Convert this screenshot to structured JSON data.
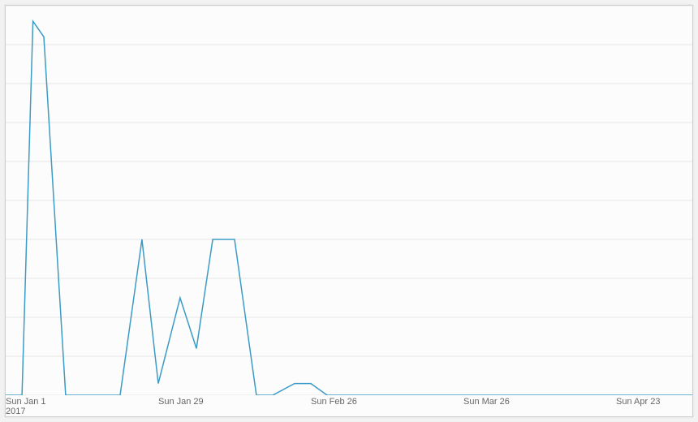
{
  "chart_data": {
    "type": "line",
    "x": [
      "2017-01-01",
      "2017-01-04",
      "2017-01-06",
      "2017-01-08",
      "2017-01-12",
      "2017-01-15",
      "2017-01-22",
      "2017-01-26",
      "2017-01-29",
      "2017-02-02",
      "2017-02-05",
      "2017-02-08",
      "2017-02-12",
      "2017-02-16",
      "2017-02-19",
      "2017-02-23",
      "2017-02-26",
      "2017-03-01",
      "2017-03-05",
      "2017-03-26",
      "2017-04-23",
      "2017-05-07"
    ],
    "values": [
      0,
      0,
      96,
      92,
      0,
      0,
      0,
      40,
      3,
      25,
      12,
      40,
      40,
      0,
      0,
      3,
      3,
      0,
      0,
      0,
      0,
      0
    ],
    "title": "",
    "xlabel": "",
    "ylabel": "",
    "ylim": [
      0,
      100
    ],
    "xlim": [
      "2017-01-01",
      "2017-05-07"
    ],
    "grid": true,
    "x_ticks": [
      {
        "date": "2017-01-01",
        "label": "Sun Jan 1",
        "sublabel": "2017"
      },
      {
        "date": "2017-01-29",
        "label": "Sun Jan 29"
      },
      {
        "date": "2017-02-26",
        "label": "Sun Feb 26"
      },
      {
        "date": "2017-03-26",
        "label": "Sun Mar 26"
      },
      {
        "date": "2017-04-23",
        "label": "Sun Apr 23"
      }
    ],
    "y_gridlines": [
      0,
      10,
      20,
      30,
      40,
      50,
      60,
      70,
      80,
      90,
      100
    ],
    "series_color": "#3b9bc6"
  }
}
